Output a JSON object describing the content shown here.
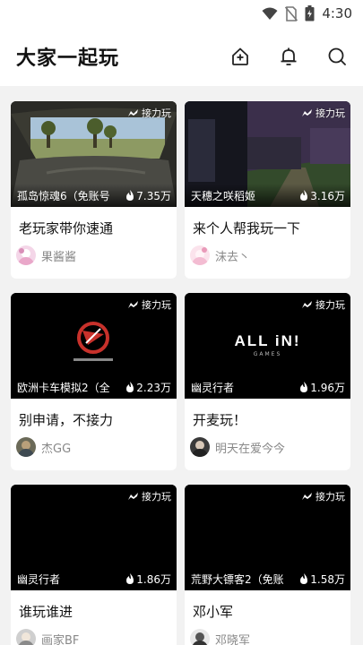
{
  "status_bar": {
    "time": "4:30"
  },
  "header": {
    "title": "大家一起玩"
  },
  "relay_label": "接力玩",
  "cards": [
    {
      "game": "孤岛惊魂6（免账号",
      "heat": "7.35万",
      "title": "老玩家带你速通",
      "user": "果酱酱"
    },
    {
      "game": "天穗之咲稻姬",
      "heat": "3.16万",
      "title": "来个人帮我玩一下",
      "user": "沫去丶"
    },
    {
      "game": "欧洲卡车模拟2（全",
      "heat": "2.23万",
      "title": "别申请，不接力",
      "user": "杰GG"
    },
    {
      "game": "幽灵行者",
      "heat": "1.96万",
      "title": "开麦玩！",
      "user": "明天在爱今今",
      "logo_text": "ALL iN!",
      "logo_sub": "GAMES"
    },
    {
      "game": "幽灵行者",
      "heat": "1.86万",
      "title": "谁玩谁进",
      "user": "画家BF"
    },
    {
      "game": "荒野大镖客2（免账",
      "heat": "1.58万",
      "title": "邓小军",
      "user": "邓晓军"
    }
  ]
}
